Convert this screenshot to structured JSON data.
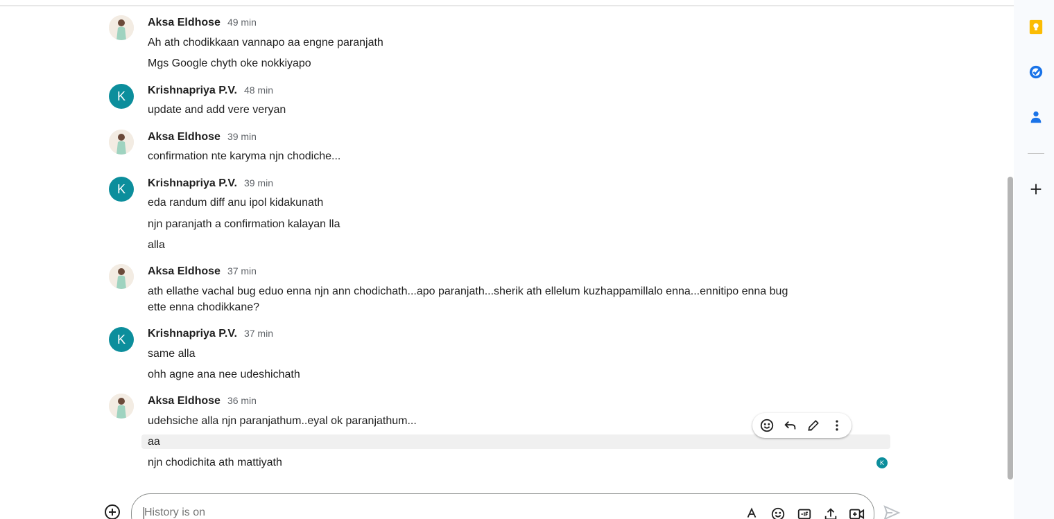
{
  "messages": [
    {
      "sender": "Aksa Eldhose",
      "time": "49 min",
      "avatar": "photo",
      "lines": [
        "Ah ath chodikkaan vannapo aa engne paranjath",
        "Mgs Google chyth oke nokkiyapo"
      ]
    },
    {
      "sender": "Krishnapriya P.V.",
      "time": "48 min",
      "avatar": "letter",
      "avatar_letter": "K",
      "lines": [
        "update and add vere veryan"
      ]
    },
    {
      "sender": "Aksa Eldhose",
      "time": "39 min",
      "avatar": "photo",
      "lines": [
        "confirmation nte karyma njn chodiche..."
      ]
    },
    {
      "sender": "Krishnapriya P.V.",
      "time": "39 min",
      "avatar": "letter",
      "avatar_letter": "K",
      "lines": [
        "eda randum diff anu ipol kidakunath",
        "njn paranjath a confirmation kalayan lla",
        "alla"
      ]
    },
    {
      "sender": "Aksa Eldhose",
      "time": "37 min",
      "avatar": "photo",
      "lines": [
        "ath ellathe vachal bug eduo enna njn ann chodichath...apo paranjath...sherik ath ellelum kuzhappamillalo enna...ennitipo enna bug ette enna chodikkane?"
      ]
    },
    {
      "sender": "Krishnapriya P.V.",
      "time": "37 min",
      "avatar": "letter",
      "avatar_letter": "K",
      "lines": [
        "same alla",
        "ohh agne ana nee udeshichath"
      ]
    },
    {
      "sender": "Aksa Eldhose",
      "time": "36 min",
      "avatar": "photo",
      "lines": [
        "udehsiche alla njn paranjathum..eyal ok paranjathum...",
        "aa",
        "njn chodichita ath mattiyath"
      ]
    }
  ],
  "read_receipt": {
    "letter": "K"
  },
  "message_toolbar": {
    "actions": [
      "emoji-reaction-icon",
      "reply-icon",
      "edit-icon",
      "more-vert-icon"
    ]
  },
  "composer": {
    "placeholder": "History is on",
    "icons": [
      "format-text-icon",
      "emoji-icon",
      "gif-icon",
      "upload-icon",
      "video-meeting-icon"
    ]
  },
  "side_panel": {
    "apps": [
      "keep-icon",
      "tasks-icon",
      "contacts-icon"
    ],
    "add": "add-icon"
  },
  "colors": {
    "avatar_teal": "#0c8e9c",
    "keep_yellow": "#fbbc04",
    "tasks_blue": "#1a73e8",
    "contacts_blue": "#1a73e8"
  }
}
